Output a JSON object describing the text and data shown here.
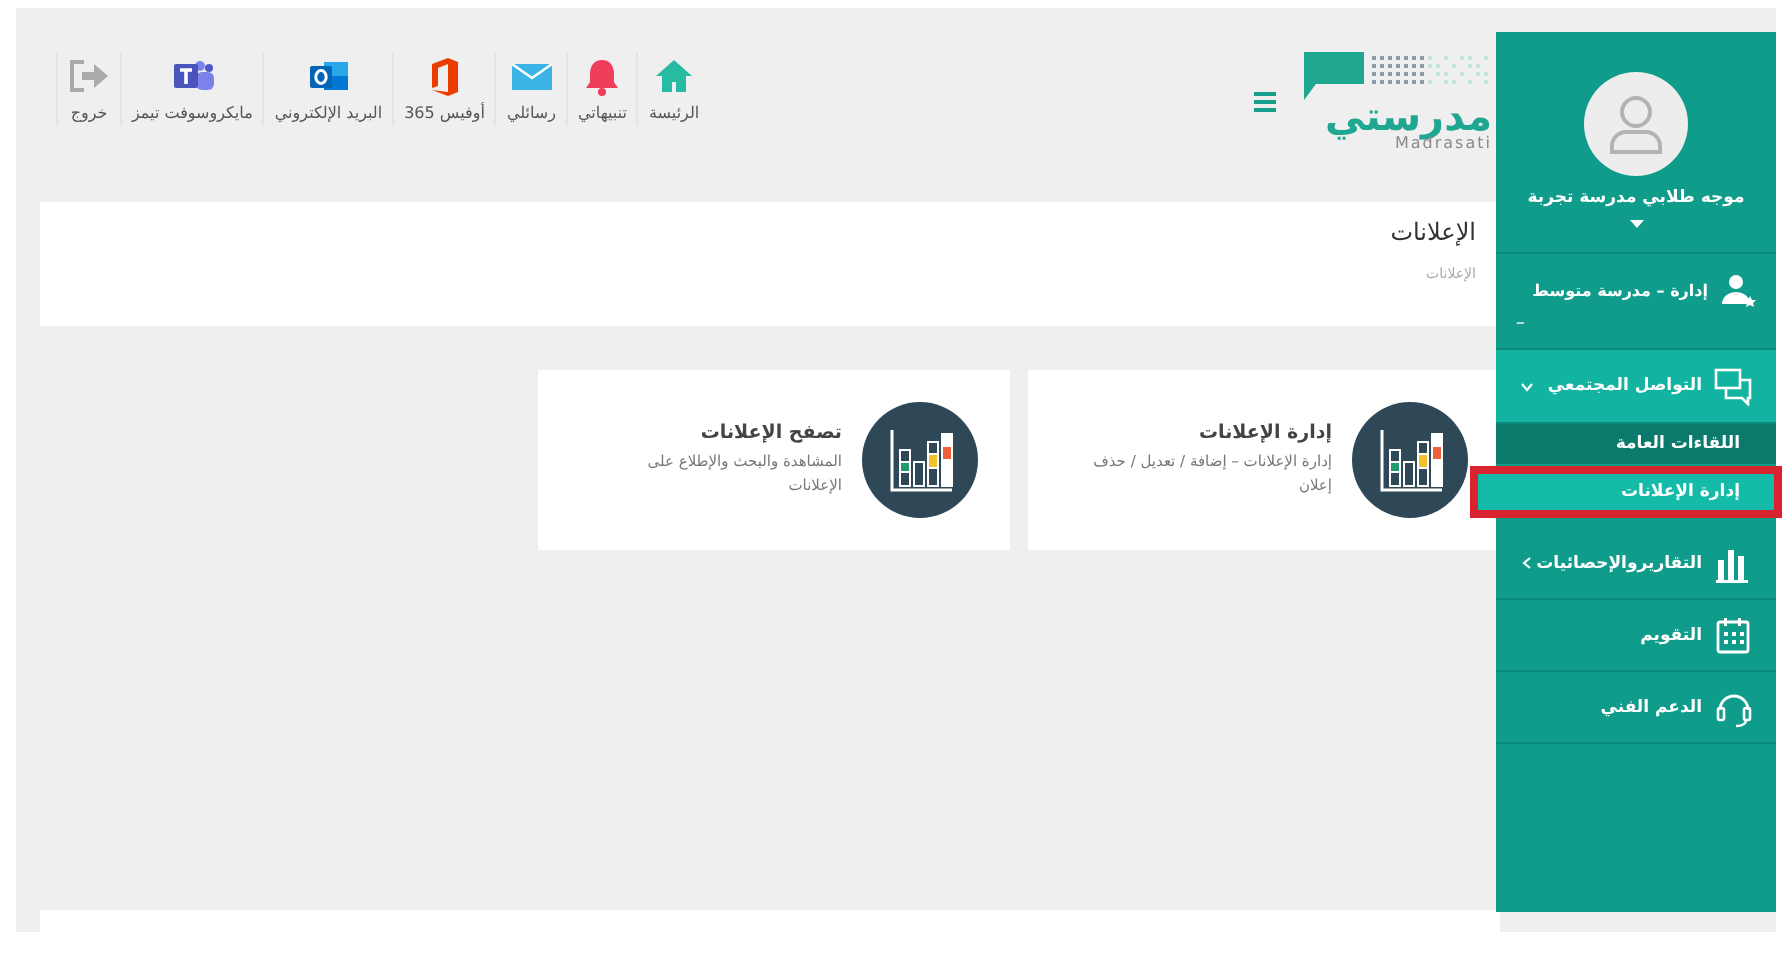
{
  "sidebar": {
    "user": {
      "name": "موجه طلابي مدرسة تجربة"
    },
    "role": {
      "label": "إدارة – مدرسة متوسط",
      "suffix": "–"
    },
    "items": [
      {
        "kind": "group",
        "label": "التواصل المجتمعي",
        "expanded": true,
        "children": [
          {
            "label": "اللقاءات العامة",
            "selected": false,
            "highlighted": false
          },
          {
            "label": "إدارة الإعلانات",
            "selected": true,
            "highlighted": true
          }
        ]
      },
      {
        "kind": "group",
        "label": "التقاريروالإحصائيات",
        "expanded": false
      },
      {
        "kind": "link",
        "label": "التقويم"
      },
      {
        "kind": "link",
        "label": "الدعم الفني"
      }
    ]
  },
  "header": {
    "logo": {
      "arabic": "مدرستي",
      "latin": "Madrasati"
    },
    "nav": [
      {
        "label": "الرئيسة"
      },
      {
        "label": "تنبيهاتي"
      },
      {
        "label": "رسائلي"
      },
      {
        "label": "أوفيس 365"
      },
      {
        "label": "البريد الإلكتروني"
      },
      {
        "label": "مايكروسوفت تيمز"
      },
      {
        "label": "خروج"
      }
    ]
  },
  "page": {
    "title": "الإعلانات",
    "breadcrumb": "الإعلانات"
  },
  "cards": [
    {
      "title": "إدارة الإعلانات",
      "description": "إدارة الإعلانات – إضافة / تعديل / حذف إعلان"
    },
    {
      "title": "تصفح الإعلانات",
      "description": "المشاهدة والبحث والإطلاع على الإعلانات"
    }
  ]
}
